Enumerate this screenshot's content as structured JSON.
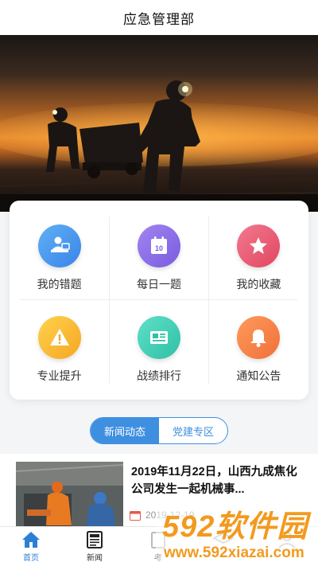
{
  "header": {
    "title": "应急管理部"
  },
  "grid": {
    "items": [
      {
        "label": "我的错题"
      },
      {
        "label": "每日一题",
        "icon_text": "10"
      },
      {
        "label": "我的收藏"
      },
      {
        "label": "专业提升"
      },
      {
        "label": "战绩排行"
      },
      {
        "label": "通知公告"
      }
    ]
  },
  "tabs": {
    "items": [
      "新闻动态",
      "党建专区"
    ],
    "active": "新闻动态"
  },
  "news": {
    "items": [
      {
        "title": "2019年11月22日，山西九成焦化公司发生一起机械事...",
        "date": "2019-12-19"
      }
    ]
  },
  "tabbar": {
    "items": [
      {
        "label": "首页"
      },
      {
        "label": "新闻"
      },
      {
        "label": "考"
      },
      {
        "label": ""
      },
      {
        "label": ""
      }
    ]
  },
  "watermark": {
    "brand": "592软件园",
    "url": "www.592xiazai.com"
  },
  "colors": {
    "accent": "#3f8fe0",
    "tabbar_active": "#2d7fd6",
    "watermark": "#f29a1f"
  }
}
